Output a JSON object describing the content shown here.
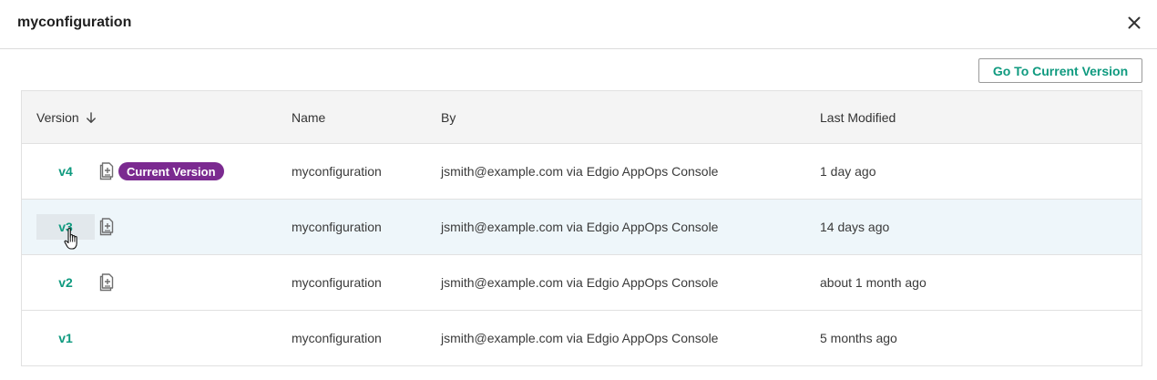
{
  "dialog": {
    "title": "myconfiguration",
    "go_to_current_label": "Go To Current Version"
  },
  "table": {
    "headers": {
      "version": "Version",
      "name": "Name",
      "by": "By",
      "last_modified": "Last Modified"
    },
    "current_badge": "Current Version",
    "rows": [
      {
        "version": "v4",
        "name": "myconfiguration",
        "by": "jsmith@example.com via Edgio AppOps Console",
        "last_modified": "1 day ago"
      },
      {
        "version": "v3",
        "name": "myconfiguration",
        "by": "jsmith@example.com via Edgio AppOps Console",
        "last_modified": "14 days ago"
      },
      {
        "version": "v2",
        "name": "myconfiguration",
        "by": "jsmith@example.com via Edgio AppOps Console",
        "last_modified": "about 1 month ago"
      },
      {
        "version": "v1",
        "name": "myconfiguration",
        "by": "jsmith@example.com via Edgio AppOps Console",
        "last_modified": "5 months ago"
      }
    ]
  },
  "colors": {
    "accent": "#0f9a7f",
    "badge": "#7b2a90",
    "hover_row": "#eef6fa"
  },
  "icons": {
    "close": "close-icon",
    "sort": "sort-descending-icon",
    "copy": "duplicate-icon",
    "cursor": "hand-pointer-cursor"
  }
}
